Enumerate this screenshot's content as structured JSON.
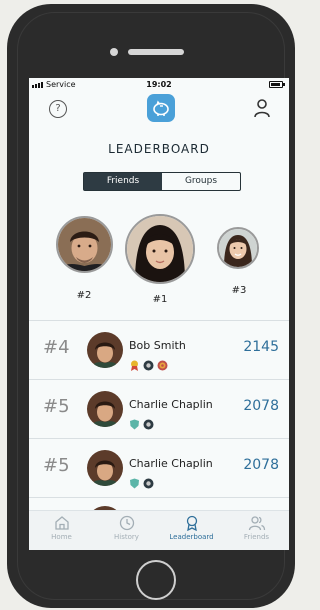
{
  "status_bar": {
    "carrier": "Service",
    "time": "19:02"
  },
  "header": {
    "help_glyph": "?",
    "logo_icon": "piggy-bank-icon",
    "profile_icon": "user-icon"
  },
  "page_title": "LEADERBOARD",
  "toggle": {
    "friends_label": "Friends",
    "groups_label": "Groups",
    "active": "Friends"
  },
  "podium": [
    {
      "rank": "#1",
      "place": "first"
    },
    {
      "rank": "#2",
      "place": "second"
    },
    {
      "rank": "#3",
      "place": "third"
    }
  ],
  "rows": [
    {
      "rank": "#4",
      "name": "Bob Smith",
      "score": "2145",
      "badges": [
        "ribbon-badge",
        "gear-badge",
        "target-badge"
      ]
    },
    {
      "rank": "#5",
      "name": "Charlie Chaplin",
      "score": "2078",
      "badges": [
        "shield-badge",
        "gear-badge"
      ]
    },
    {
      "rank": "#5",
      "name": "Charlie Chaplin",
      "score": "2078",
      "badges": [
        "shield-badge",
        "gear-badge"
      ]
    }
  ],
  "tabs": [
    {
      "label": "Home",
      "icon": "home-icon"
    },
    {
      "label": "History",
      "icon": "clock-icon"
    },
    {
      "label": "Leaderboard",
      "icon": "ribbon-icon",
      "active": true
    },
    {
      "label": "Friends",
      "icon": "friends-icon"
    }
  ],
  "colors": {
    "accent": "#2f6f9a",
    "toggle_active": "#2e3b43",
    "logo": "#4aa0d8",
    "phone_body": "#2b2b2b"
  }
}
